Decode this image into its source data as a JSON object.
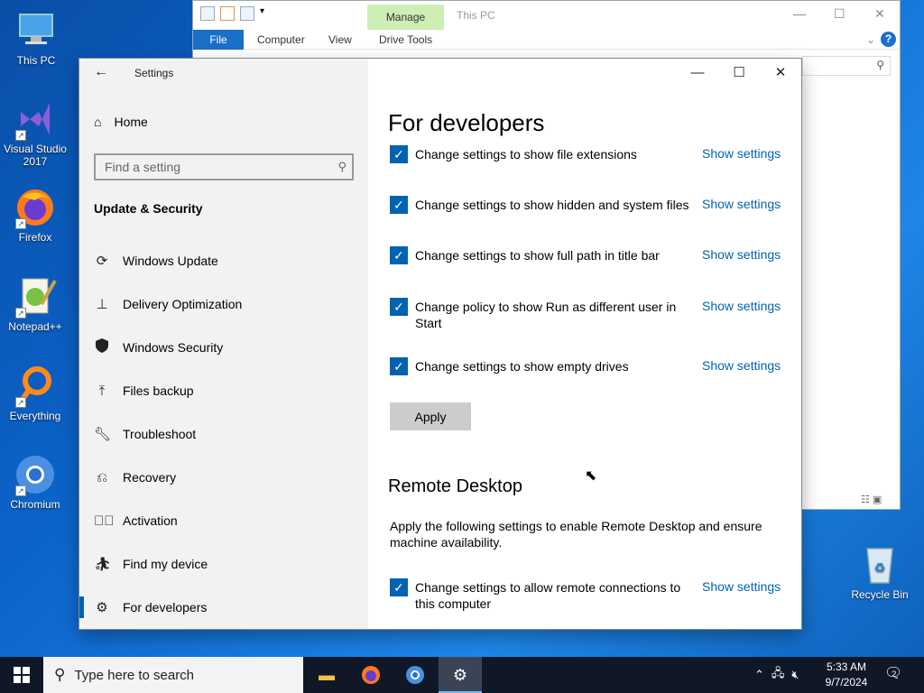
{
  "desktop": {
    "icons": [
      {
        "label": "This PC"
      },
      {
        "label": "Visual Studio 2017"
      },
      {
        "label": "Firefox"
      },
      {
        "label": "Notepad++"
      },
      {
        "label": "Everything"
      },
      {
        "label": "Chromium"
      }
    ],
    "recycle_bin": "Recycle Bin"
  },
  "explorer": {
    "title": "This PC",
    "manage_tab": "Manage",
    "tabs": {
      "file": "File",
      "computer": "Computer",
      "view": "View",
      "drive_tools": "Drive Tools"
    }
  },
  "settings": {
    "app_title": "Settings",
    "home": "Home",
    "search_placeholder": "Find a setting",
    "section": "Update & Security",
    "nav": [
      {
        "label": "Windows Update",
        "icon": "sync-icon"
      },
      {
        "label": "Delivery Optimization",
        "icon": "delivery-icon"
      },
      {
        "label": "Windows Security",
        "icon": "shield-icon"
      },
      {
        "label": "Files backup",
        "icon": "upload-icon"
      },
      {
        "label": "Troubleshoot",
        "icon": "wrench-icon"
      },
      {
        "label": "Recovery",
        "icon": "recovery-icon"
      },
      {
        "label": "Activation",
        "icon": "check-circle-icon"
      },
      {
        "label": "Find my device",
        "icon": "person-pin-icon"
      },
      {
        "label": "For developers",
        "icon": "developer-icon",
        "active": true
      }
    ],
    "page_title": "For developers",
    "options": [
      {
        "label": "Change settings to show file extensions",
        "checked": true,
        "link": "Show settings"
      },
      {
        "label": "Change settings to show hidden and system files",
        "checked": true,
        "link": "Show settings"
      },
      {
        "label": "Change settings to show full path in title bar",
        "checked": true,
        "link": "Show settings"
      },
      {
        "label": "Change policy to show Run as different user in Start",
        "checked": true,
        "link": "Show settings"
      },
      {
        "label": "Change settings to show empty drives",
        "checked": true,
        "link": "Show settings"
      }
    ],
    "apply_label": "Apply",
    "remote_title": "Remote Desktop",
    "remote_desc": "Apply the following settings to enable Remote Desktop and ensure machine availability.",
    "remote_option": {
      "label": "Change settings to allow remote connections to this computer",
      "checked": true,
      "link": "Show settings"
    }
  },
  "taskbar": {
    "search_placeholder": "Type here to search",
    "time": "5:33 AM",
    "date": "9/7/2024",
    "notification_count": "2"
  },
  "colors": {
    "accent": "#0063b1",
    "taskbar": "#101828"
  }
}
